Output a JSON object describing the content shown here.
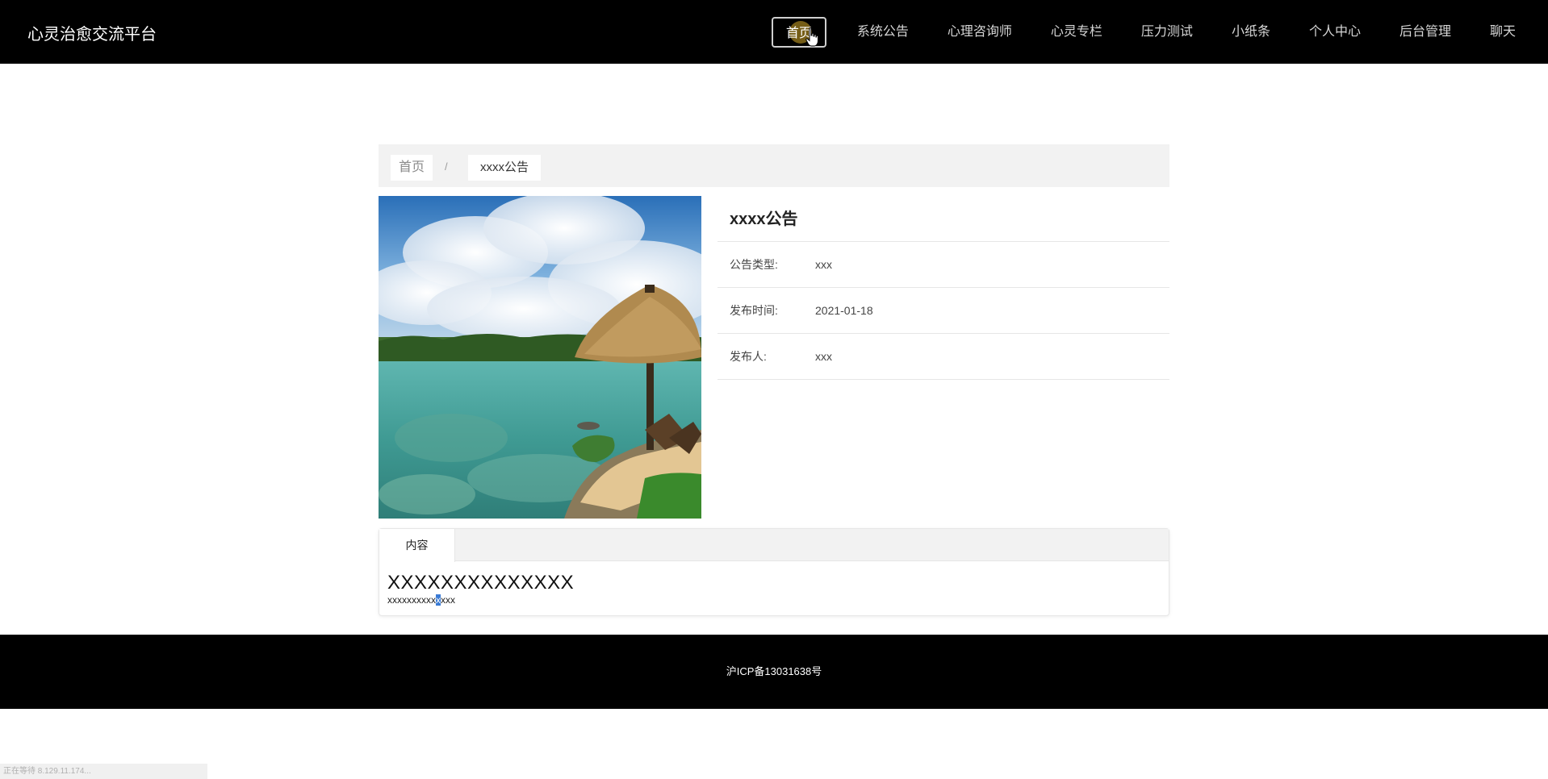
{
  "header": {
    "brand": "心灵治愈交流平台",
    "nav": [
      {
        "label": "首页",
        "active": true
      },
      {
        "label": "系统公告"
      },
      {
        "label": "心理咨询师"
      },
      {
        "label": "心灵专栏"
      },
      {
        "label": "压力测试"
      },
      {
        "label": "小纸条"
      },
      {
        "label": "个人中心"
      },
      {
        "label": "后台管理"
      },
      {
        "label": "聊天"
      }
    ]
  },
  "breadcrumb": {
    "home": "首页",
    "separator": "/",
    "current": "xxxx公告"
  },
  "detail": {
    "title": "xxxx公告",
    "rows": [
      {
        "label": "公告类型:",
        "value": "xxx"
      },
      {
        "label": "发布时间:",
        "value": "2021-01-18"
      },
      {
        "label": "发布人:",
        "value": "xxx"
      }
    ]
  },
  "tabs": {
    "active_label": "内容",
    "heading": "XXXXXXXXXXXXXX",
    "para_before": "xxxxxxxxxx",
    "para_selected": "x",
    "para_after": "xxx"
  },
  "footer": {
    "icp": "沪ICP备13031638号"
  },
  "status_bar": {
    "text": "正在等待 8.129.11.174..."
  },
  "colors": {
    "nav_bg": "#000000",
    "footer_bg": "#000000",
    "crumb_bg": "#f2f2f2",
    "selection": "#3a7bd5"
  }
}
